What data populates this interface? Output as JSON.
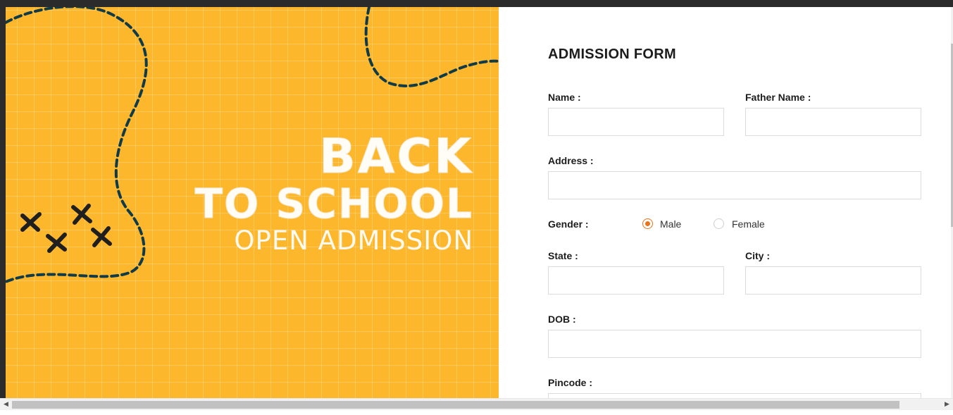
{
  "hero": {
    "line1": "BACK",
    "line2": "TO SCHOOL",
    "line3": "OPEN ADMISSION",
    "background_color": "#fdb72d",
    "ink_color": "#0f3a48"
  },
  "form": {
    "title": "ADMISSION FORM",
    "name_label": "Name :",
    "name_value": "",
    "father_name_label": "Father Name :",
    "father_name_value": "",
    "address_label": "Address :",
    "address_value": "",
    "gender_label": "Gender :",
    "gender_options": [
      "Male",
      "Female"
    ],
    "gender_selected": "Male",
    "state_label": "State :",
    "state_value": "",
    "city_label": "City :",
    "city_value": "",
    "dob_label": "DOB :",
    "dob_value": "",
    "pincode_label": "Pincode :",
    "pincode_value": "",
    "accent_color": "#e8731a"
  },
  "scrollbar": {
    "left_arrow": "◀",
    "right_arrow": "▶"
  }
}
